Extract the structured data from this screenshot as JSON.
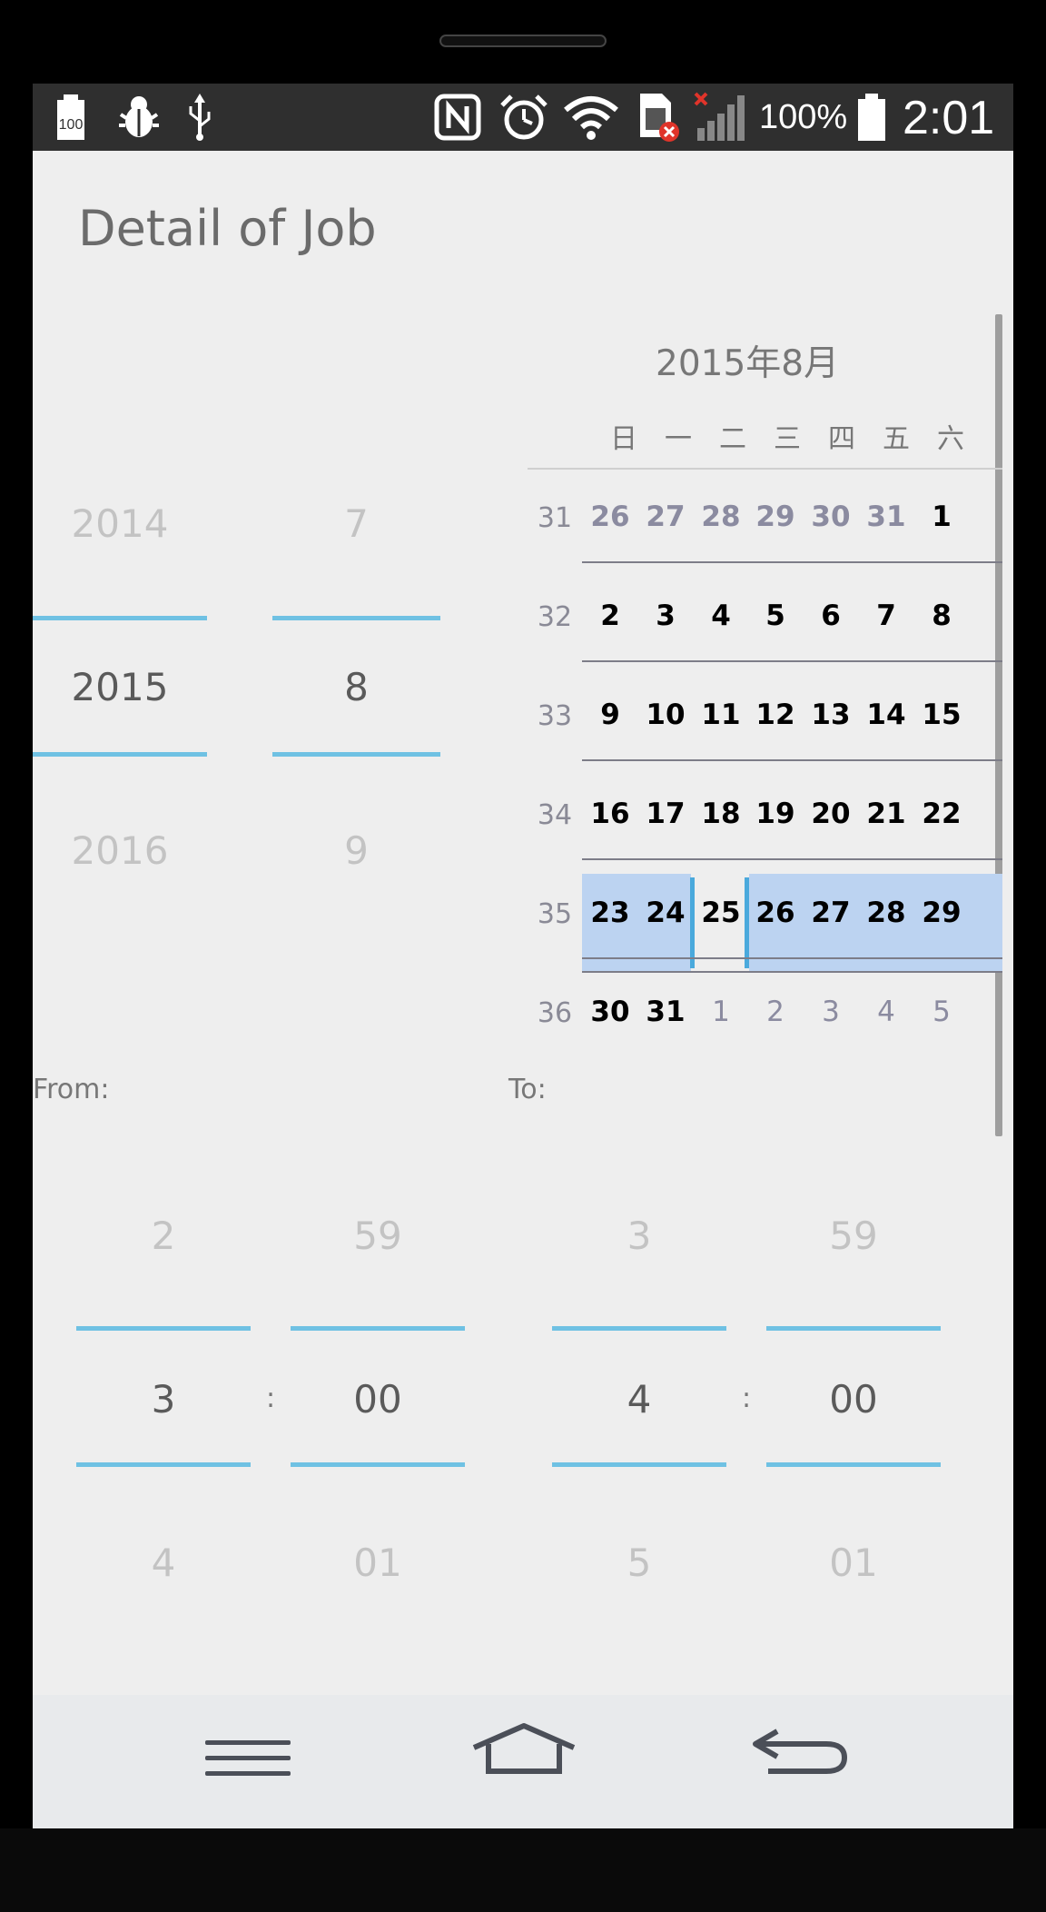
{
  "status_bar": {
    "battery_saver_label": "100",
    "battery_percent": "100%",
    "time": "2:01",
    "icons": [
      "battery-100-icon",
      "bug-icon",
      "usb-icon",
      "nfc-icon",
      "alarm-icon",
      "wifi-icon",
      "sim-error-icon",
      "signal-icon",
      "battery-icon"
    ]
  },
  "title": "Detail of Job",
  "date_picker": {
    "year": {
      "prev": "2014",
      "selected": "2015",
      "next": "2016"
    },
    "month": {
      "prev": "7",
      "selected": "8",
      "next": "9"
    }
  },
  "calendar": {
    "header": "2015年8月",
    "weekdays": [
      "日",
      "一",
      "二",
      "三",
      "四",
      "五",
      "六"
    ],
    "weeks": [
      {
        "week": "31",
        "days": [
          "26",
          "27",
          "28",
          "29",
          "30",
          "31",
          "1"
        ]
      },
      {
        "week": "32",
        "days": [
          "2",
          "3",
          "4",
          "5",
          "6",
          "7",
          "8"
        ]
      },
      {
        "week": "33",
        "days": [
          "9",
          "10",
          "11",
          "12",
          "13",
          "14",
          "15"
        ]
      },
      {
        "week": "34",
        "days": [
          "16",
          "17",
          "18",
          "19",
          "20",
          "21",
          "22"
        ]
      },
      {
        "week": "35",
        "days": [
          "23",
          "24",
          "25",
          "26",
          "27",
          "28",
          "29"
        ]
      },
      {
        "week": "36",
        "days": [
          "30",
          "31",
          "1",
          "2",
          "3",
          "4",
          "5"
        ]
      }
    ],
    "selected_day": "25"
  },
  "from": {
    "label": "From:",
    "hour": {
      "prev": "2",
      "selected": "3",
      "next": "4"
    },
    "minute": {
      "prev": "59",
      "selected": "00",
      "next": "01"
    },
    "separator": ":"
  },
  "to": {
    "label": "To:",
    "hour": {
      "prev": "3",
      "selected": "4",
      "next": "5"
    },
    "minute": {
      "prev": "59",
      "selected": "00",
      "next": "01"
    },
    "separator": ":"
  },
  "nav_bar": {
    "icons": [
      "menu-icon",
      "home-icon",
      "back-icon"
    ]
  },
  "colors": {
    "accent": "#6fc1e3",
    "highlight": "#bcd3f1",
    "background": "#eeeeee"
  }
}
